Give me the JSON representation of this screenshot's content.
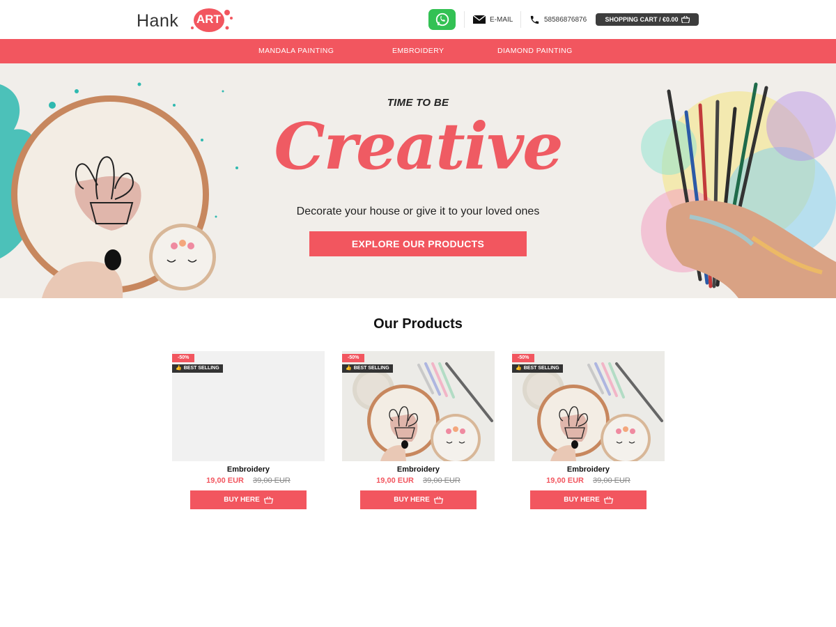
{
  "header": {
    "logo_text": "Hank",
    "logo_badge": "ART",
    "email_label": "E-MAIL",
    "phone": "58586876876",
    "cart_label": "SHOPPING CART / €0.00"
  },
  "nav": {
    "items": [
      {
        "label": "MANDALA PAINTING"
      },
      {
        "label": "EMBROIDERY"
      },
      {
        "label": "DIAMOND PAINTING"
      }
    ]
  },
  "hero": {
    "kicker": "TIME TO BE",
    "title": "Creative",
    "subtitle": "Decorate your house or give it to your loved ones",
    "cta": "EXPLORE OUR PRODUCTS"
  },
  "products": {
    "title": "Our Products",
    "items": [
      {
        "sale_badge": "-50%",
        "best_badge": "BEST SELLING",
        "name": "Embroidery",
        "price": "19,00 EUR",
        "old_price": "39,00 EUR",
        "button": "BUY HERE",
        "has_image": false
      },
      {
        "sale_badge": "-50%",
        "best_badge": "BEST SELLING",
        "name": "Embroidery",
        "price": "19,00 EUR",
        "old_price": "39,00 EUR",
        "button": "BUY HERE",
        "has_image": true
      },
      {
        "sale_badge": "-50%",
        "best_badge": "BEST SELLING",
        "name": "Embroidery",
        "price": "19,00 EUR",
        "old_price": "39,00 EUR",
        "button": "BUY HERE",
        "has_image": true
      }
    ]
  },
  "colors": {
    "accent": "#f2565f",
    "dark": "#3d3d3d",
    "whatsapp": "#33c154",
    "hero_bg": "#f1eeea"
  },
  "icons": [
    "whatsapp-icon",
    "mail-icon",
    "phone-icon",
    "basket-icon",
    "thumbs-up-icon"
  ]
}
